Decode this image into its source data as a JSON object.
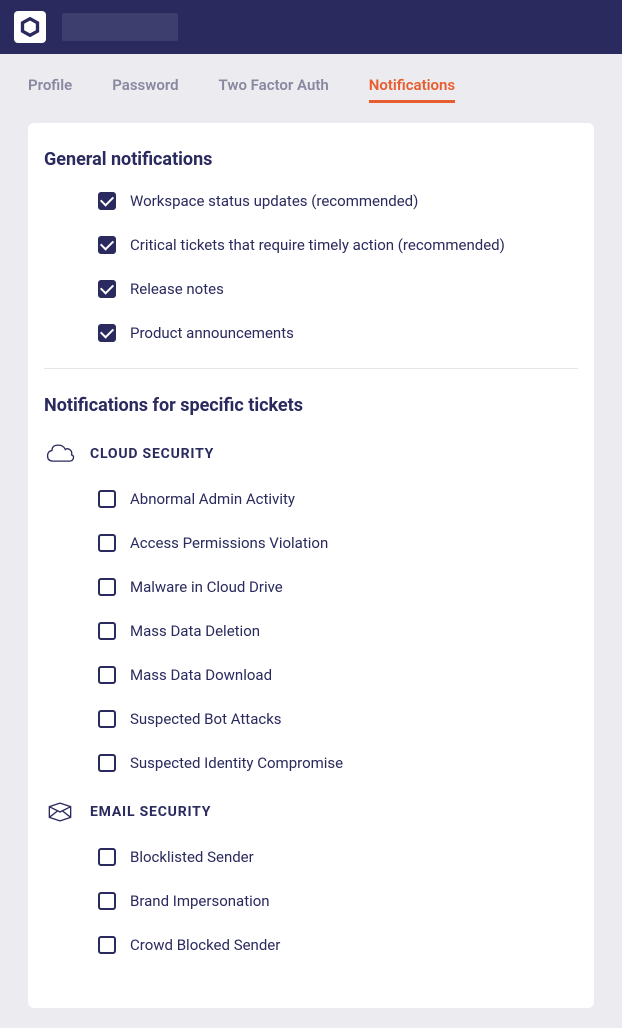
{
  "tabs": [
    {
      "label": "Profile",
      "active": false
    },
    {
      "label": "Password",
      "active": false
    },
    {
      "label": "Two Factor Auth",
      "active": false
    },
    {
      "label": "Notifications",
      "active": true
    }
  ],
  "sections": {
    "general": {
      "title": "General notifications",
      "options": [
        {
          "label": "Workspace status updates (recommended)",
          "checked": true
        },
        {
          "label": "Critical tickets that require timely action (recommended)",
          "checked": true
        },
        {
          "label": "Release notes",
          "checked": true
        },
        {
          "label": "Product announcements",
          "checked": true
        }
      ]
    },
    "specific": {
      "title": "Notifications for specific tickets",
      "categories": [
        {
          "name": "CLOUD SECURITY",
          "icon": "cloud",
          "options": [
            {
              "label": "Abnormal Admin Activity",
              "checked": false
            },
            {
              "label": "Access Permissions Violation",
              "checked": false
            },
            {
              "label": "Malware in Cloud Drive",
              "checked": false
            },
            {
              "label": "Mass Data Deletion",
              "checked": false
            },
            {
              "label": "Mass Data Download",
              "checked": false
            },
            {
              "label": "Suspected Bot Attacks",
              "checked": false
            },
            {
              "label": "Suspected Identity Compromise",
              "checked": false
            }
          ]
        },
        {
          "name": "EMAIL SECURITY",
          "icon": "envelope",
          "options": [
            {
              "label": "Blocklisted Sender",
              "checked": false
            },
            {
              "label": "Brand Impersonation",
              "checked": false
            },
            {
              "label": "Crowd Blocked Sender",
              "checked": false
            }
          ]
        }
      ]
    }
  }
}
